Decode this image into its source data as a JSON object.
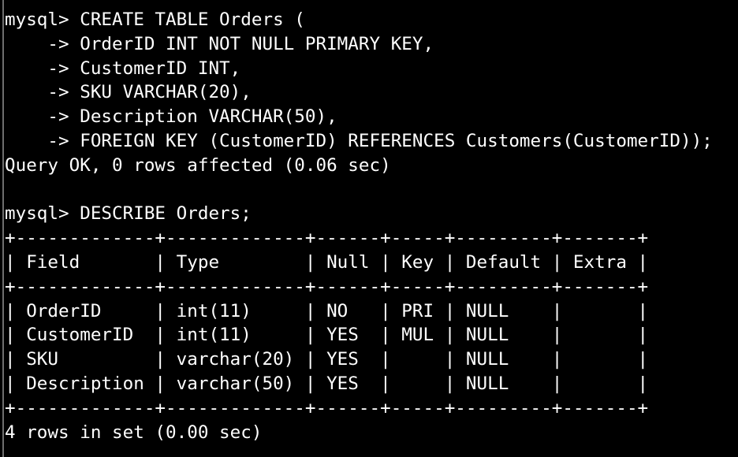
{
  "terminal": {
    "lines": [
      "mysql> CREATE TABLE Orders (",
      "    -> OrderID INT NOT NULL PRIMARY KEY,",
      "    -> CustomerID INT,",
      "    -> SKU VARCHAR(20),",
      "    -> Description VARCHAR(50),",
      "    -> FOREIGN KEY (CustomerID) REFERENCES Customers(CustomerID));",
      "Query OK, 0 rows affected (0.06 sec)",
      "",
      "mysql> DESCRIBE Orders;",
      "+-------------+-------------+------+-----+---------+-------+",
      "| Field       | Type        | Null | Key | Default | Extra |",
      "+-------------+-------------+------+-----+---------+-------+",
      "| OrderID     | int(11)     | NO   | PRI | NULL    |       |",
      "| CustomerID  | int(11)     | YES  | MUL | NULL    |       |",
      "| SKU         | varchar(20) | YES  |     | NULL    |       |",
      "| Description | varchar(50) | YES  |     | NULL    |       |",
      "+-------------+-------------+------+-----+---------+-------+",
      "4 rows in set (0.00 sec)"
    ]
  },
  "colors": {
    "background": "#000000",
    "foreground": "#ffffff"
  }
}
